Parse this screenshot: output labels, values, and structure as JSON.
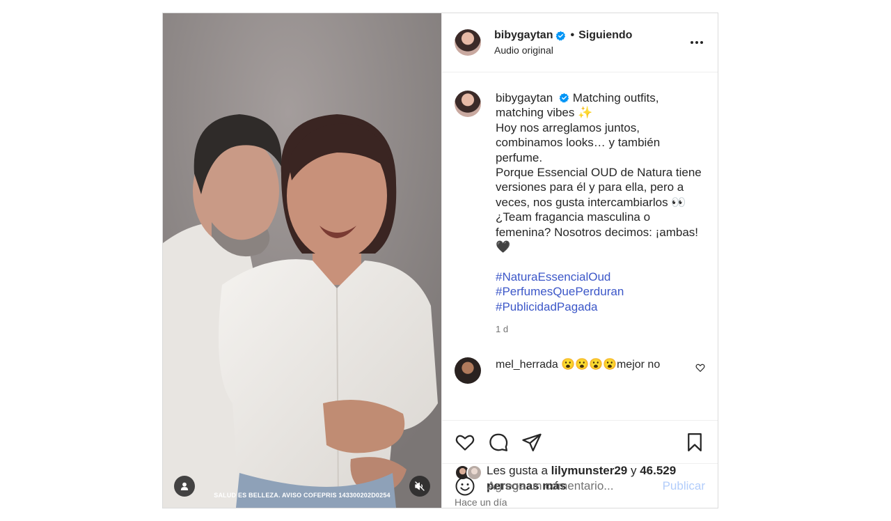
{
  "post": {
    "account": {
      "username": "bibygaytan",
      "verified": true,
      "separator": "•",
      "follow_state": "Siguiendo",
      "audio": "Audio original"
    },
    "media": {
      "disclaimer": "SALUD ES BELLEZA. AVISO COFEPRIS 143300202D0254",
      "icons": [
        "user-tag-icon",
        "muted-speaker-icon"
      ]
    },
    "caption": {
      "username": "bibygaytan",
      "lines": [
        "Matching outfits, matching vibes ✨",
        "Hoy nos arreglamos juntos, combinamos looks… y también perfume.",
        "Porque Essencial OUD de Natura tiene versiones para él y para ella, pero a veces, nos gusta intercambiarlos 👀",
        "¿Team fragancia masculina o femenina? Nosotros decimos: ¡ambas! 🖤"
      ],
      "hashtags": [
        "#NaturaEssencialOud",
        "#PerfumesQuePerduran",
        "#PublicidadPagada"
      ],
      "age": "1 d"
    },
    "next_comment": {
      "username": "mel_herrada",
      "text": "😮😮😮😮mejor no"
    },
    "likes": {
      "prefix": "Les gusta a",
      "liker": "lilymunster29",
      "conjunction": "y",
      "count_text": "46.529 personas más"
    },
    "time": "Hace un día",
    "comment_box": {
      "placeholder": "Agrega un comentario...",
      "publish_label": "Publicar"
    }
  },
  "colors": {
    "verified": "#0095f6",
    "hashtag": "#3c57c8",
    "publish_disabled": "#b2cdfb",
    "muted_text": "#737373"
  }
}
